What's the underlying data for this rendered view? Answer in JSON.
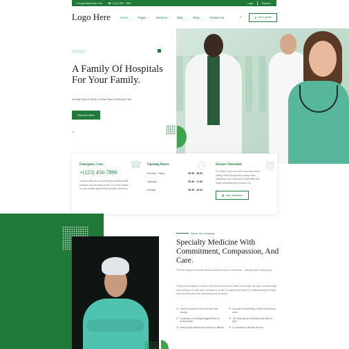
{
  "topbar": {
    "email": "support@domain.com",
    "phone": "+(123) 456 - 7890",
    "login": "Login",
    "register": "Register"
  },
  "header": {
    "logo": "Logo Here",
    "nav": [
      "Home",
      "Pages",
      "Services",
      "Blog",
      "Shop",
      "Contact Us"
    ],
    "active_nav": "Home",
    "quote_button": "Get a quote"
  },
  "hero": {
    "title": "A Family Of Hospitals For Your Family.",
    "subtitle": "A Great Place to Work. A Great Place to Receive Care.",
    "button": "Discover More"
  },
  "info": {
    "emergency": {
      "title": "Emergency Case",
      "phone": "+(123) 456-7890",
      "desc": "Conduct planned, unforeseen procedures while powerful and technical issues. For more details on any medical appointment please contact us."
    },
    "hours": {
      "title": "Opening Hours",
      "rows": [
        {
          "day": "Monday - Friday",
          "time": "09.30 - 18.30"
        },
        {
          "day": "Saturday",
          "time": "09.30 - 17.30"
        },
        {
          "day": "Sunday",
          "time": "09.30 - 15.30"
        }
      ]
    },
    "timetable": {
      "title": "Doctors Timetable",
      "desc": "For those of you who are concerned about timing, better doing some spring focus yesterday more success is achievable with some understanding of what to do.",
      "button": "View Timetable"
    }
  },
  "about": {
    "label": "About our company",
    "title": "Specialty Medicine With Commitment, Compassion, And Care.",
    "p1": "The first thing to remember about success is that it is a process – nothing more, nothing less.",
    "p2": "There is real magic in it and it's not reserved only for a select few people. As such, success really has nothing to do with luck, coincidence or fate. It really comes down to understanding the steps in the process and then executing on those steps.",
    "features": [
      "See the success in the mind and start moving",
      "Success is something of which we all want more",
      "Conscious or by single biggest factor in achievement",
      "The best way is to develop and follow a plan",
      "Most people believe that success is difficult",
      "It's possible to fail with the first"
    ]
  },
  "icons": {
    "email": "envelope-icon",
    "phone": "phone-icon",
    "search": "search-icon",
    "quote": "plus-circle-icon",
    "chevron": "chevron-down-icon",
    "check": "check-circle-icon"
  },
  "colors": {
    "brand": "#1f7a3a",
    "accent": "#3fa34d"
  }
}
